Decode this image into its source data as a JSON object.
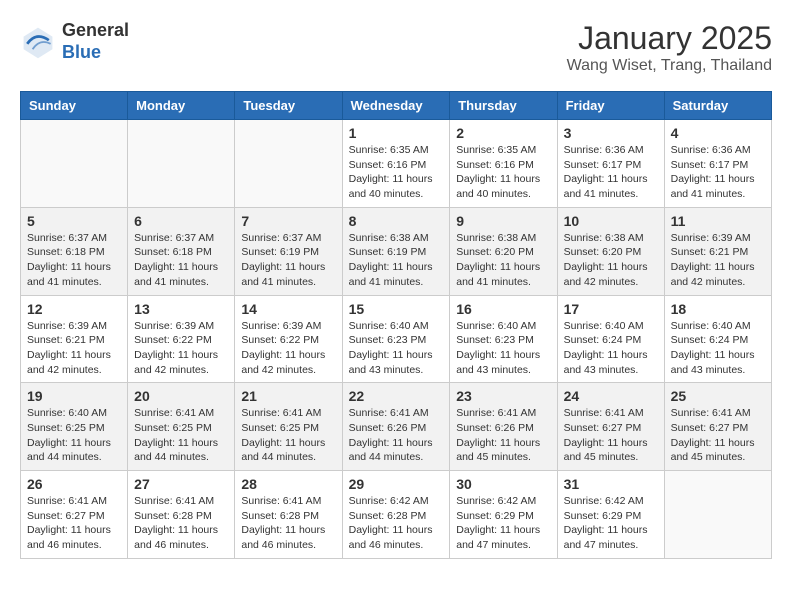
{
  "header": {
    "logo_general": "General",
    "logo_blue": "Blue",
    "month": "January 2025",
    "location": "Wang Wiset, Trang, Thailand"
  },
  "weekdays": [
    "Sunday",
    "Monday",
    "Tuesday",
    "Wednesday",
    "Thursday",
    "Friday",
    "Saturday"
  ],
  "weeks": [
    [
      {
        "day": "",
        "info": ""
      },
      {
        "day": "",
        "info": ""
      },
      {
        "day": "",
        "info": ""
      },
      {
        "day": "1",
        "info": "Sunrise: 6:35 AM\nSunset: 6:16 PM\nDaylight: 11 hours\nand 40 minutes."
      },
      {
        "day": "2",
        "info": "Sunrise: 6:35 AM\nSunset: 6:16 PM\nDaylight: 11 hours\nand 40 minutes."
      },
      {
        "day": "3",
        "info": "Sunrise: 6:36 AM\nSunset: 6:17 PM\nDaylight: 11 hours\nand 41 minutes."
      },
      {
        "day": "4",
        "info": "Sunrise: 6:36 AM\nSunset: 6:17 PM\nDaylight: 11 hours\nand 41 minutes."
      }
    ],
    [
      {
        "day": "5",
        "info": "Sunrise: 6:37 AM\nSunset: 6:18 PM\nDaylight: 11 hours\nand 41 minutes."
      },
      {
        "day": "6",
        "info": "Sunrise: 6:37 AM\nSunset: 6:18 PM\nDaylight: 11 hours\nand 41 minutes."
      },
      {
        "day": "7",
        "info": "Sunrise: 6:37 AM\nSunset: 6:19 PM\nDaylight: 11 hours\nand 41 minutes."
      },
      {
        "day": "8",
        "info": "Sunrise: 6:38 AM\nSunset: 6:19 PM\nDaylight: 11 hours\nand 41 minutes."
      },
      {
        "day": "9",
        "info": "Sunrise: 6:38 AM\nSunset: 6:20 PM\nDaylight: 11 hours\nand 41 minutes."
      },
      {
        "day": "10",
        "info": "Sunrise: 6:38 AM\nSunset: 6:20 PM\nDaylight: 11 hours\nand 42 minutes."
      },
      {
        "day": "11",
        "info": "Sunrise: 6:39 AM\nSunset: 6:21 PM\nDaylight: 11 hours\nand 42 minutes."
      }
    ],
    [
      {
        "day": "12",
        "info": "Sunrise: 6:39 AM\nSunset: 6:21 PM\nDaylight: 11 hours\nand 42 minutes."
      },
      {
        "day": "13",
        "info": "Sunrise: 6:39 AM\nSunset: 6:22 PM\nDaylight: 11 hours\nand 42 minutes."
      },
      {
        "day": "14",
        "info": "Sunrise: 6:39 AM\nSunset: 6:22 PM\nDaylight: 11 hours\nand 42 minutes."
      },
      {
        "day": "15",
        "info": "Sunrise: 6:40 AM\nSunset: 6:23 PM\nDaylight: 11 hours\nand 43 minutes."
      },
      {
        "day": "16",
        "info": "Sunrise: 6:40 AM\nSunset: 6:23 PM\nDaylight: 11 hours\nand 43 minutes."
      },
      {
        "day": "17",
        "info": "Sunrise: 6:40 AM\nSunset: 6:24 PM\nDaylight: 11 hours\nand 43 minutes."
      },
      {
        "day": "18",
        "info": "Sunrise: 6:40 AM\nSunset: 6:24 PM\nDaylight: 11 hours\nand 43 minutes."
      }
    ],
    [
      {
        "day": "19",
        "info": "Sunrise: 6:40 AM\nSunset: 6:25 PM\nDaylight: 11 hours\nand 44 minutes."
      },
      {
        "day": "20",
        "info": "Sunrise: 6:41 AM\nSunset: 6:25 PM\nDaylight: 11 hours\nand 44 minutes."
      },
      {
        "day": "21",
        "info": "Sunrise: 6:41 AM\nSunset: 6:25 PM\nDaylight: 11 hours\nand 44 minutes."
      },
      {
        "day": "22",
        "info": "Sunrise: 6:41 AM\nSunset: 6:26 PM\nDaylight: 11 hours\nand 44 minutes."
      },
      {
        "day": "23",
        "info": "Sunrise: 6:41 AM\nSunset: 6:26 PM\nDaylight: 11 hours\nand 45 minutes."
      },
      {
        "day": "24",
        "info": "Sunrise: 6:41 AM\nSunset: 6:27 PM\nDaylight: 11 hours\nand 45 minutes."
      },
      {
        "day": "25",
        "info": "Sunrise: 6:41 AM\nSunset: 6:27 PM\nDaylight: 11 hours\nand 45 minutes."
      }
    ],
    [
      {
        "day": "26",
        "info": "Sunrise: 6:41 AM\nSunset: 6:27 PM\nDaylight: 11 hours\nand 46 minutes."
      },
      {
        "day": "27",
        "info": "Sunrise: 6:41 AM\nSunset: 6:28 PM\nDaylight: 11 hours\nand 46 minutes."
      },
      {
        "day": "28",
        "info": "Sunrise: 6:41 AM\nSunset: 6:28 PM\nDaylight: 11 hours\nand 46 minutes."
      },
      {
        "day": "29",
        "info": "Sunrise: 6:42 AM\nSunset: 6:28 PM\nDaylight: 11 hours\nand 46 minutes."
      },
      {
        "day": "30",
        "info": "Sunrise: 6:42 AM\nSunset: 6:29 PM\nDaylight: 11 hours\nand 47 minutes."
      },
      {
        "day": "31",
        "info": "Sunrise: 6:42 AM\nSunset: 6:29 PM\nDaylight: 11 hours\nand 47 minutes."
      },
      {
        "day": "",
        "info": ""
      }
    ]
  ]
}
